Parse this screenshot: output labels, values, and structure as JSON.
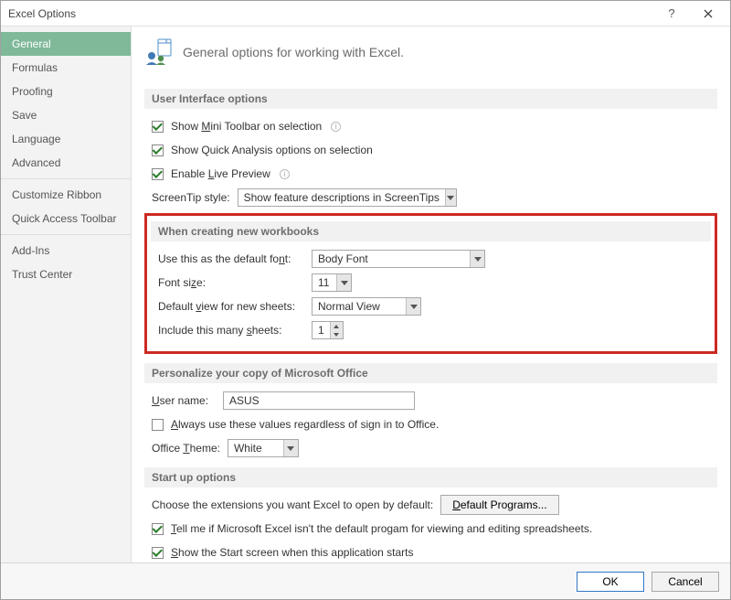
{
  "window": {
    "title": "Excel Options"
  },
  "nav": {
    "items": [
      {
        "label": "General",
        "selected": true
      },
      {
        "label": "Formulas"
      },
      {
        "label": "Proofing"
      },
      {
        "label": "Save"
      },
      {
        "label": "Language"
      },
      {
        "label": "Advanced"
      },
      {
        "sep": true
      },
      {
        "label": "Customize Ribbon"
      },
      {
        "label": "Quick Access Toolbar"
      },
      {
        "sep": true
      },
      {
        "label": "Add-Ins"
      },
      {
        "label": "Trust Center"
      }
    ]
  },
  "hero": {
    "text": "General options for working with Excel."
  },
  "ui_options": {
    "header": "User Interface options",
    "mini_toolbar_pre": "Show ",
    "mini_toolbar_u": "M",
    "mini_toolbar_post": "ini Toolbar on selection",
    "quick_analysis": "Show Quick Analysis options on selection",
    "live_preview_pre": "Enable ",
    "live_preview_u": "L",
    "live_preview_post": "ive Preview",
    "screentip_label": "ScreenTip style:",
    "screentip_value": "Show feature descriptions in ScreenTips"
  },
  "new_wb": {
    "header": "When creating new workbooks",
    "font_label_pre": "Use this as the default fo",
    "font_label_u": "n",
    "font_label_post": "t:",
    "font_value": "Body Font",
    "size_label_pre": "Font si",
    "size_label_u": "z",
    "size_label_post": "e:",
    "size_value": "11",
    "view_label_pre": "Default ",
    "view_label_u": "v",
    "view_label_post": "iew for new sheets:",
    "view_value": "Normal View",
    "sheets_label_pre": "Include this many ",
    "sheets_label_u": "s",
    "sheets_label_post": "heets:",
    "sheets_value": "1"
  },
  "personalize": {
    "header": "Personalize your copy of Microsoft Office",
    "user_label_u": "U",
    "user_label_post": "ser name:",
    "user_value": "ASUS",
    "always_u": "A",
    "always_post": "lways use these values regardless of sign in to Office.",
    "theme_label_pre": "Office ",
    "theme_label_u": "T",
    "theme_label_post": "heme:",
    "theme_value": "White"
  },
  "startup": {
    "header": "Start up options",
    "choose_text": "Choose the extensions you want Excel to open by default:",
    "default_programs_u": "D",
    "default_programs_post": "efault Programs...",
    "tell_u": "T",
    "tell_post": "ell me if Microsoft Excel isn't the default progam for viewing and editing spreadsheets.",
    "show_u": "S",
    "show_post": "how the Start screen when this application starts"
  },
  "footer": {
    "ok": "OK",
    "cancel": "Cancel"
  }
}
